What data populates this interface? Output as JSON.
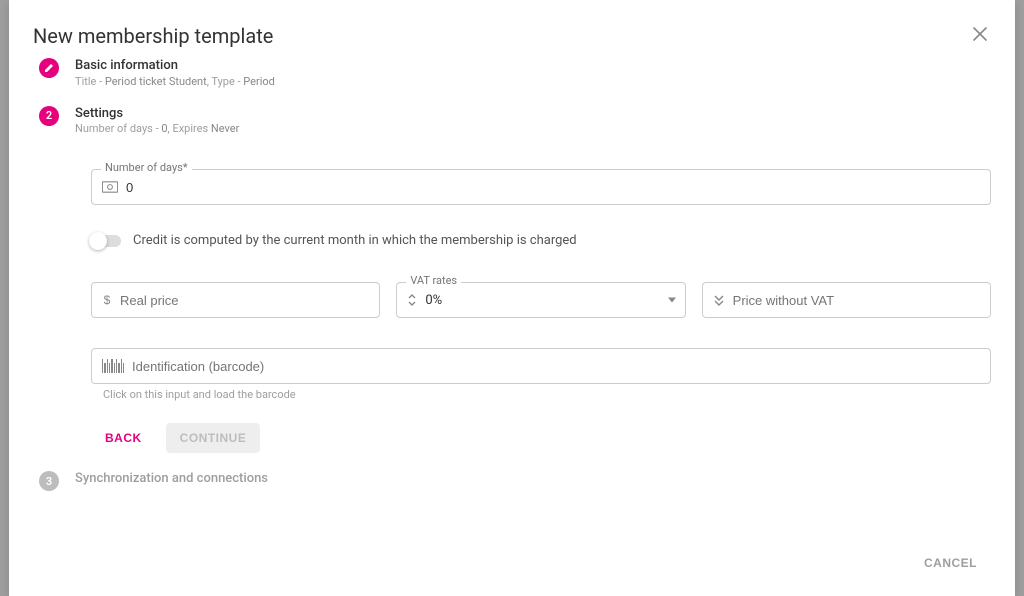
{
  "modal": {
    "title": "New membership template",
    "cancel_label": "CANCEL"
  },
  "steps": {
    "s1": {
      "title": "Basic information",
      "sub_prefix_title": "Title - ",
      "sub_title_value": "Period ticket Student",
      "sub_sep": ", ",
      "sub_prefix_type": "Type - ",
      "sub_type_value": "Period"
    },
    "s2": {
      "badge": "2",
      "title": "Settings",
      "sub_prefix_days": "Number of days - ",
      "sub_days_value": "0",
      "sub_sep": ", ",
      "sub_prefix_exp": "Expires ",
      "sub_exp_value": "Never"
    },
    "s3": {
      "badge": "3",
      "title": "Synchronization and connections"
    }
  },
  "form": {
    "days": {
      "label": "Number of days*",
      "value": "0"
    },
    "toggle": {
      "label": "Credit is computed by the current month in which the membership is charged"
    },
    "real_price": {
      "placeholder": "Real price"
    },
    "vat": {
      "label": "VAT rates",
      "value": "0%"
    },
    "price_wo_vat": {
      "placeholder": "Price without VAT"
    },
    "barcode": {
      "placeholder": "Identification (barcode)",
      "helper": "Click on this input and load the barcode"
    },
    "back_label": "BACK",
    "continue_label": "CONTINUE"
  }
}
